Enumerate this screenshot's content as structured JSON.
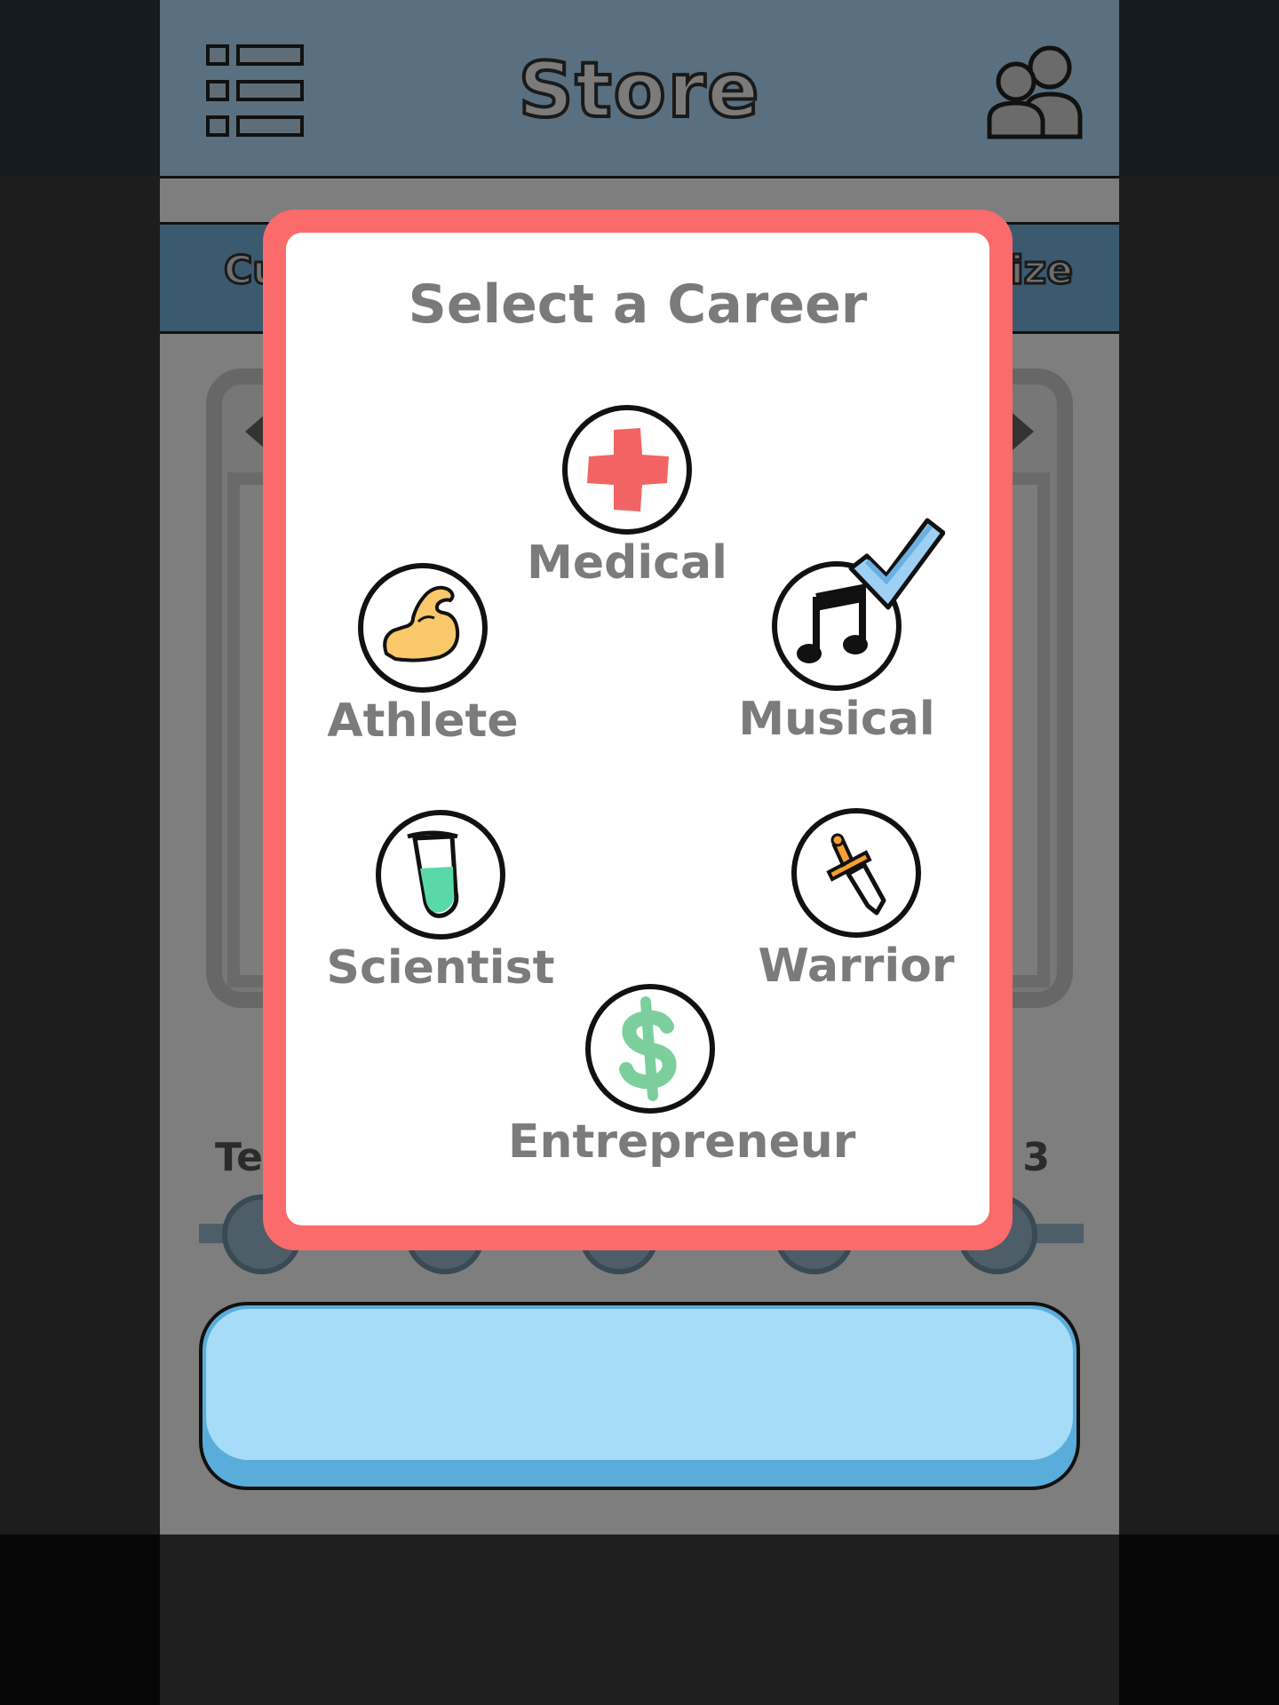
{
  "header": {
    "title": "Store",
    "menu_icon": "list-menu-icon",
    "friends_icon": "friends-icon"
  },
  "background": {
    "tab_left": "Cu",
    "tab_right": "ize",
    "level_left": "Te",
    "level_right": "t 3"
  },
  "modal": {
    "title": "Select a Career",
    "careers": [
      {
        "label": "Medical",
        "icon": "medical-cross-icon",
        "selected": false
      },
      {
        "label": "Athlete",
        "icon": "flexed-bicep-icon",
        "selected": false
      },
      {
        "label": "Musical",
        "icon": "music-note-icon",
        "selected": true
      },
      {
        "label": "Scientist",
        "icon": "test-tube-icon",
        "selected": false
      },
      {
        "label": "Warrior",
        "icon": "sword-icon",
        "selected": false
      },
      {
        "label": "Entrepreneur",
        "icon": "dollar-sign-icon",
        "selected": false
      }
    ]
  },
  "colors": {
    "modal_border": "#fb6b6b",
    "topbar": "#5a7080",
    "primary_button": "#a6dcf8",
    "checkmark": "#8cc6ee",
    "label": "#7b7b7b"
  }
}
